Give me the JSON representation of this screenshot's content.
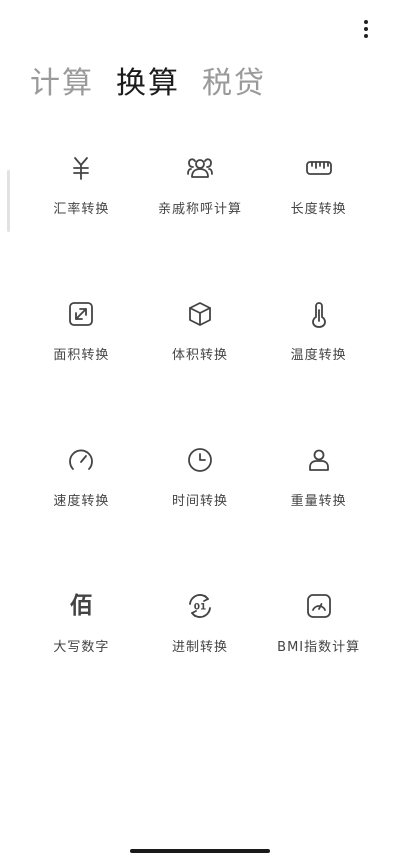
{
  "tabs": [
    {
      "label": "计算",
      "active": false
    },
    {
      "label": "换算",
      "active": true
    },
    {
      "label": "税贷",
      "active": false
    }
  ],
  "tools": [
    {
      "label": "汇率转换",
      "icon": "yuan-icon"
    },
    {
      "label": "亲戚称呼计算",
      "icon": "people-icon"
    },
    {
      "label": "长度转换",
      "icon": "ruler-icon"
    },
    {
      "label": "面积转换",
      "icon": "expand-arrow-icon"
    },
    {
      "label": "体积转换",
      "icon": "cube-icon"
    },
    {
      "label": "温度转换",
      "icon": "thermometer-icon"
    },
    {
      "label": "速度转换",
      "icon": "speedometer-icon"
    },
    {
      "label": "时间转换",
      "icon": "clock-icon"
    },
    {
      "label": "重量转换",
      "icon": "weight-icon"
    },
    {
      "label": "大写数字",
      "icon": "bai-char-icon",
      "glyph": "佰"
    },
    {
      "label": "进制转换",
      "icon": "binary-icon",
      "glyph": "01"
    },
    {
      "label": "BMI指数计算",
      "icon": "gauge-icon"
    }
  ]
}
